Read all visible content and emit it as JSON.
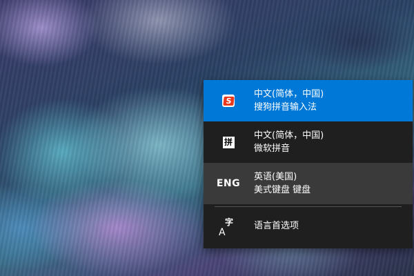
{
  "flyout": {
    "items": [
      {
        "language": "中文(简体，中国)",
        "method": "搜狗拼音输入法",
        "badge": "S",
        "icon": "sogou-icon",
        "state": "selected"
      },
      {
        "language": "中文(简体，中国)",
        "method": "微软拼音",
        "badge": "拼",
        "icon": "pinyin-icon",
        "state": "normal"
      },
      {
        "language": "英语(美国)",
        "method": "美式键盘 键盘",
        "badge": "ENG",
        "icon": "eng-icon",
        "state": "hovered"
      }
    ],
    "preferences": {
      "label": "语言首选项",
      "icon_big": "A",
      "icon_small": "字",
      "icon": "language-preferences-icon"
    }
  },
  "colors": {
    "selected": "#0078d7",
    "hover": "#3a3a3a",
    "flyout_bg": "#1f1f1f",
    "sogou_red": "#e8391f"
  }
}
